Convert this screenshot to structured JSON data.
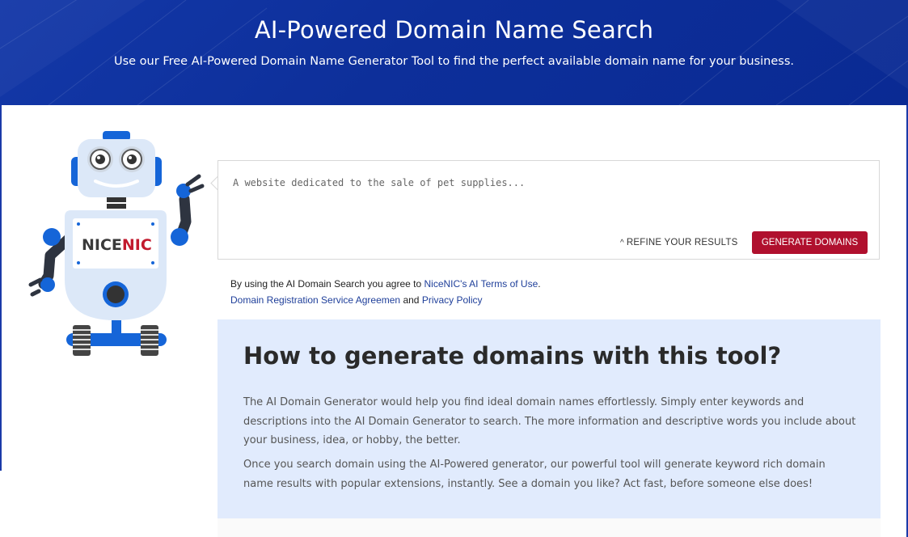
{
  "hero": {
    "title": "AI-Powered Domain Name Search",
    "subtitle": "Use our Free AI-Powered Domain Name Generator Tool to find the perfect available domain name for your business."
  },
  "robot": {
    "logo_part1": "NICE",
    "logo_part2": "NIC",
    "logo_color_dark": "#3a3a3a",
    "logo_color_red": "#c21a2e"
  },
  "search": {
    "placeholder": "A website dedicated to the sale of pet supplies...",
    "refine_label": "REFINE YOUR RESULTS",
    "refine_icon": "chevron-up-icon",
    "generate_label": "GENERATE DOMAINS"
  },
  "terms": {
    "prefix": "By using the AI Domain Search you agree to ",
    "link1": "NiceNIC's AI Terms of Use",
    "period": ".",
    "link2": "Domain Registration Service Agreemen",
    "and": " and ",
    "link3": "Privacy Policy"
  },
  "howto": {
    "heading": "How to generate domains with this tool?",
    "para1": "The AI Domain Generator would help you find ideal domain names effortlessly. Simply enter keywords and descriptions into the AI Domain Generator to search. The more information and descriptive words you include about your business, idea, or hobby, the better.",
    "para2": "Once you search domain using the AI-Powered generator, our powerful tool will generate keyword rich domain name results with popular extensions, instantly. See a domain you like? Act fast, before someone else does!"
  },
  "colors": {
    "hero_bg": "#0d2f9a",
    "accent_red": "#b0102e",
    "link_blue": "#1f3f9a",
    "info_bg": "#e1ebfd",
    "robot_blue": "#1565d8"
  }
}
